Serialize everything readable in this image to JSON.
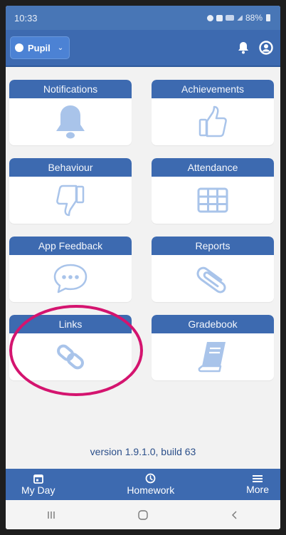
{
  "status_bar": {
    "time": "10:33",
    "battery": "88%"
  },
  "header": {
    "selector_label": "Pupil"
  },
  "tiles": [
    {
      "label": "Notifications",
      "icon": "bell-icon"
    },
    {
      "label": "Achievements",
      "icon": "thumbs-up-icon"
    },
    {
      "label": "Behaviour",
      "icon": "thumbs-down-icon"
    },
    {
      "label": "Attendance",
      "icon": "table-grid-icon"
    },
    {
      "label": "App Feedback",
      "icon": "speech-bubble-icon"
    },
    {
      "label": "Reports",
      "icon": "paperclip-icon"
    },
    {
      "label": "Links",
      "icon": "chain-link-icon"
    },
    {
      "label": "Gradebook",
      "icon": "book-icon"
    }
  ],
  "version": "version 1.9.1.0, build 63",
  "bottom_nav": [
    {
      "label": "My Day",
      "icon": "calendar-icon"
    },
    {
      "label": "Homework",
      "icon": "clock-icon"
    },
    {
      "label": "More",
      "icon": "menu-icon"
    }
  ],
  "colors": {
    "primary": "#3d6ab0",
    "icon": "#a9c4ea",
    "highlight": "#d4146f"
  }
}
